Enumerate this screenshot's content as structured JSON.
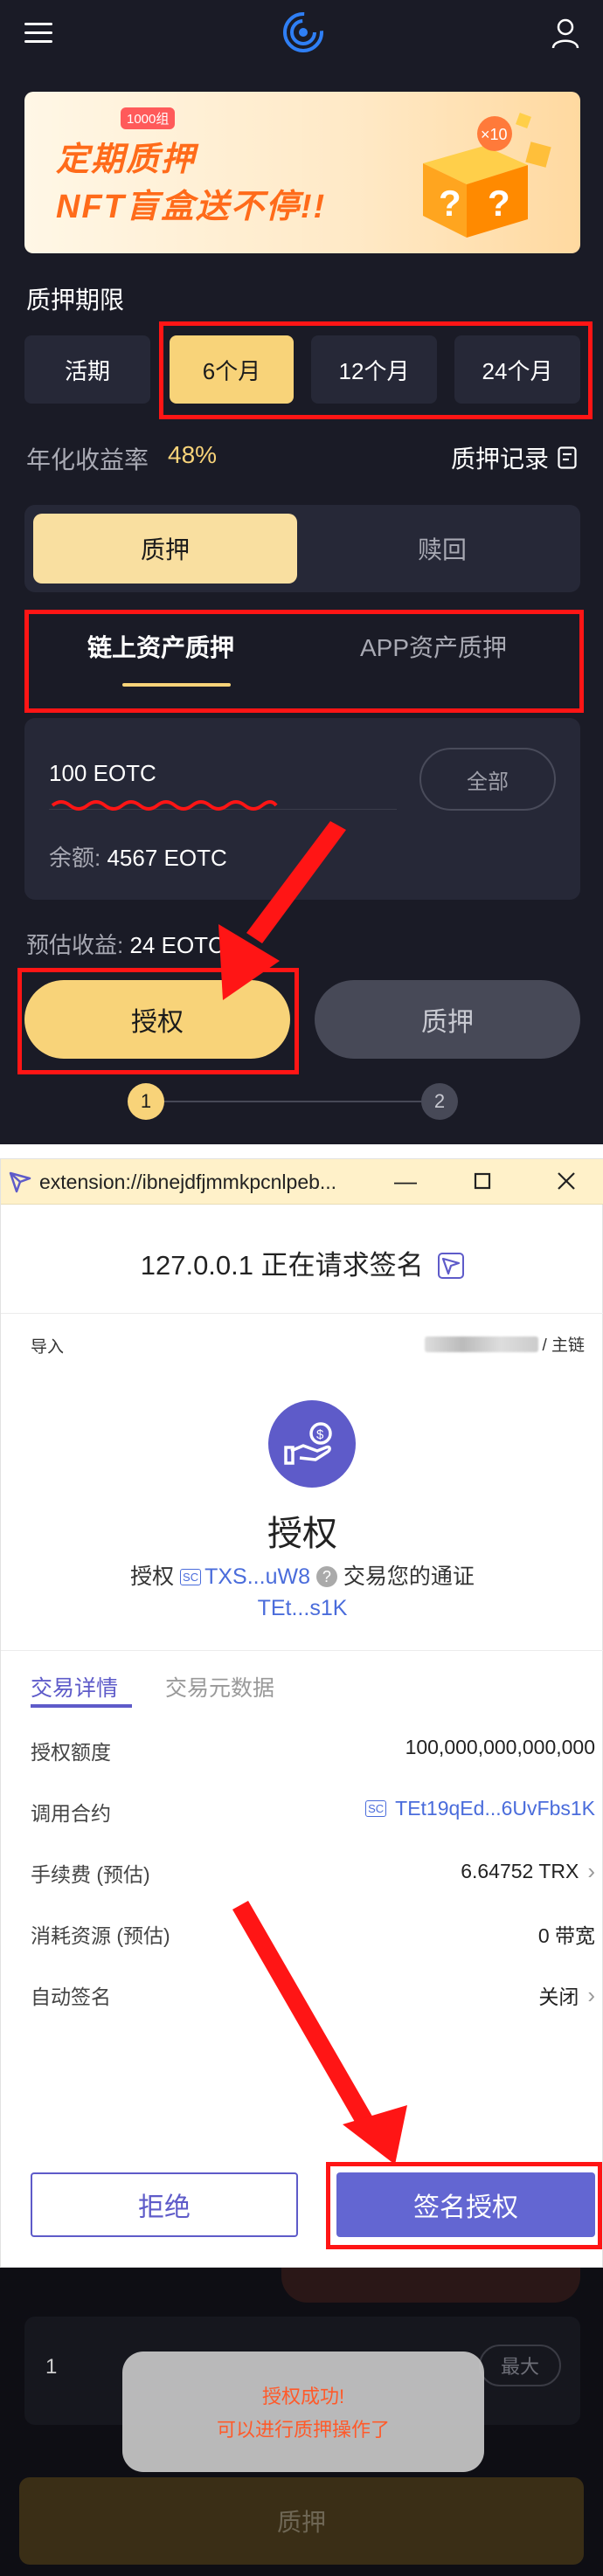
{
  "app": {
    "banner": {
      "tag": "1000组",
      "line1": "定期质押",
      "line2": "NFT盲盒送不停!!",
      "box_label": "×10"
    },
    "period_title": "质押期限",
    "periods": [
      "活期",
      "6个月",
      "12个月",
      "24个月"
    ],
    "selected_period": "6个月",
    "apy_label": "年化收益率",
    "apy_value": "48%",
    "record_label": "质押记录",
    "mode_tabs": {
      "stake": "质押",
      "redeem": "赎回"
    },
    "asset_tabs": {
      "onchain": "链上资产质押",
      "app": "APP资产质押"
    },
    "amount_value": "100 EOTC",
    "max_label": "全部",
    "balance_label": "余额:",
    "balance_value": "4567 EOTC",
    "est_label": "预估收益:",
    "est_value": "24 EOTC",
    "authorize_button": "授权",
    "stake_button": "质押",
    "steps": [
      "1",
      "2"
    ]
  },
  "popup": {
    "title": "extension://ibnejdfjmmkpcnlpeb...",
    "request_title": "127.0.0.1 正在请求签名",
    "import_label": "导入",
    "network_suffix": "/ 主链",
    "action_title": "授权",
    "desc_prefix": "授权",
    "sc_badge": "SC",
    "spender_short": "TXS...uW8",
    "desc_suffix": "交易您的通证",
    "token_short": "TEt...s1K",
    "tabs": {
      "details": "交易详情",
      "meta": "交易元数据"
    },
    "rows": [
      {
        "label": "授权额度",
        "value": "100,000,000,000,000"
      },
      {
        "label": "调用合约",
        "value": "TEt19qEd...6UvFbs1K"
      },
      {
        "label": "手续费 (预估)",
        "value": "6.64752 TRX"
      },
      {
        "label": "消耗资源 (预估)",
        "value": "0 带宽"
      },
      {
        "label": "自动签名",
        "value": "关闭"
      }
    ],
    "reject_button": "拒绝",
    "sign_button": "签名授权"
  },
  "bottom": {
    "amount_value": "1",
    "max_label": "最大",
    "stake_button": "质押",
    "toast_line1": "授权成功!",
    "toast_line2": "可以进行质押操作了"
  },
  "colors": {
    "app_bg": "#1a1b26",
    "accent_gold": "#f8d379",
    "highlight_red": "#ff1515",
    "popup_primary": "#5e5bc9",
    "link_blue": "#4a6cdb"
  }
}
